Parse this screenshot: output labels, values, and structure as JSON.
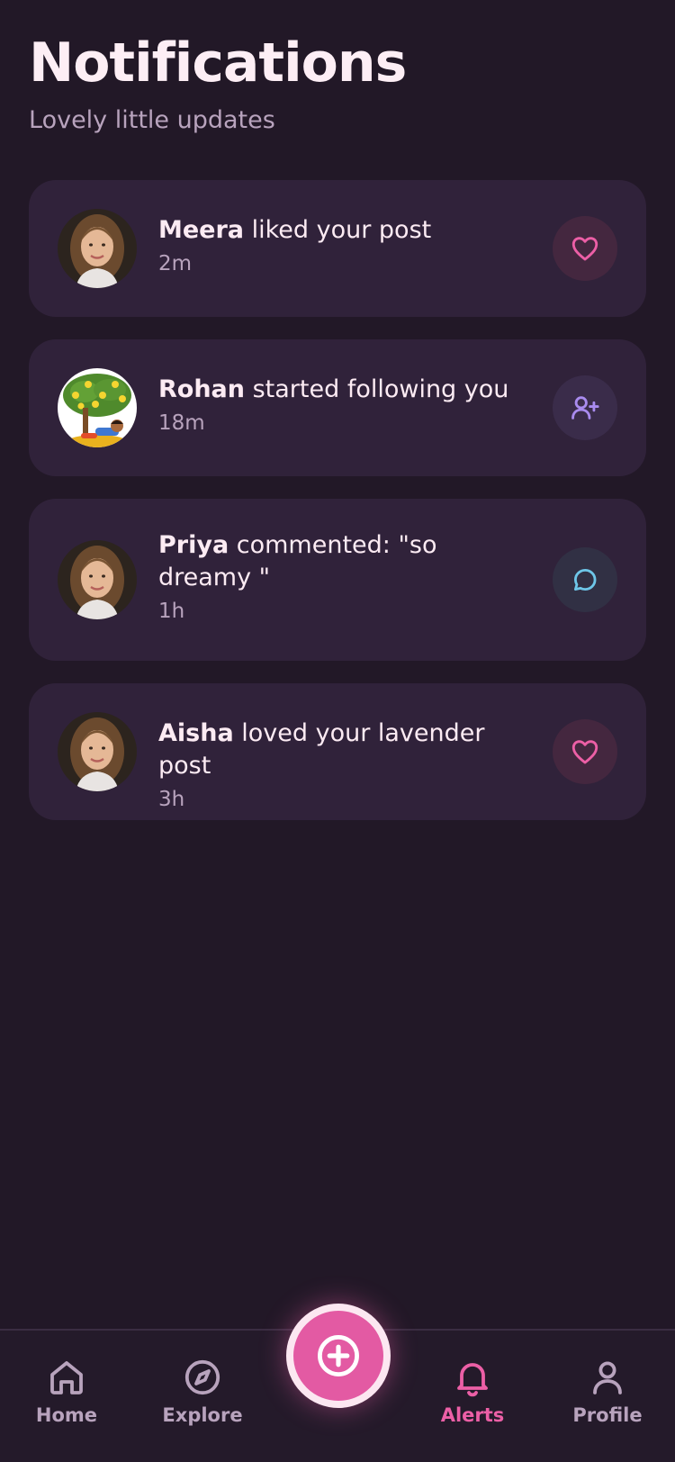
{
  "header": {
    "title": "Notifications",
    "subtitle": "Lovely little updates"
  },
  "notifications": [
    {
      "user": "Meera",
      "message": " liked your post",
      "time": "2m",
      "action_icon": "heart-icon",
      "avatar": "woman-portrait"
    },
    {
      "user": "Rohan",
      "message": " started following you",
      "time": "18m",
      "action_icon": "user-plus-icon",
      "avatar": "boy-under-lemon-tree"
    },
    {
      "user": "Priya",
      "message": " commented: \"so dreamy \"",
      "time": "1h",
      "action_icon": "comment-bubble-icon",
      "avatar": "woman-portrait"
    },
    {
      "user": "Aisha",
      "message": " loved your lavender post",
      "time": "3h",
      "action_icon": "heart-icon",
      "avatar": "woman-portrait"
    }
  ],
  "nav": {
    "items": [
      {
        "label": "Home",
        "icon": "home-icon"
      },
      {
        "label": "Explore",
        "icon": "compass-icon"
      },
      {
        "label": "Alerts",
        "icon": "bell-icon",
        "active": true
      },
      {
        "label": "Profile",
        "icon": "user-icon"
      }
    ],
    "fab_icon": "plus-circle-icon"
  },
  "colors": {
    "background": "#221827",
    "card": "#30223a",
    "accent": "#ec5fa6",
    "muted_text": "#b8a3bd",
    "follow_icon": "#a98bef",
    "comment_icon": "#6ec6e8"
  }
}
